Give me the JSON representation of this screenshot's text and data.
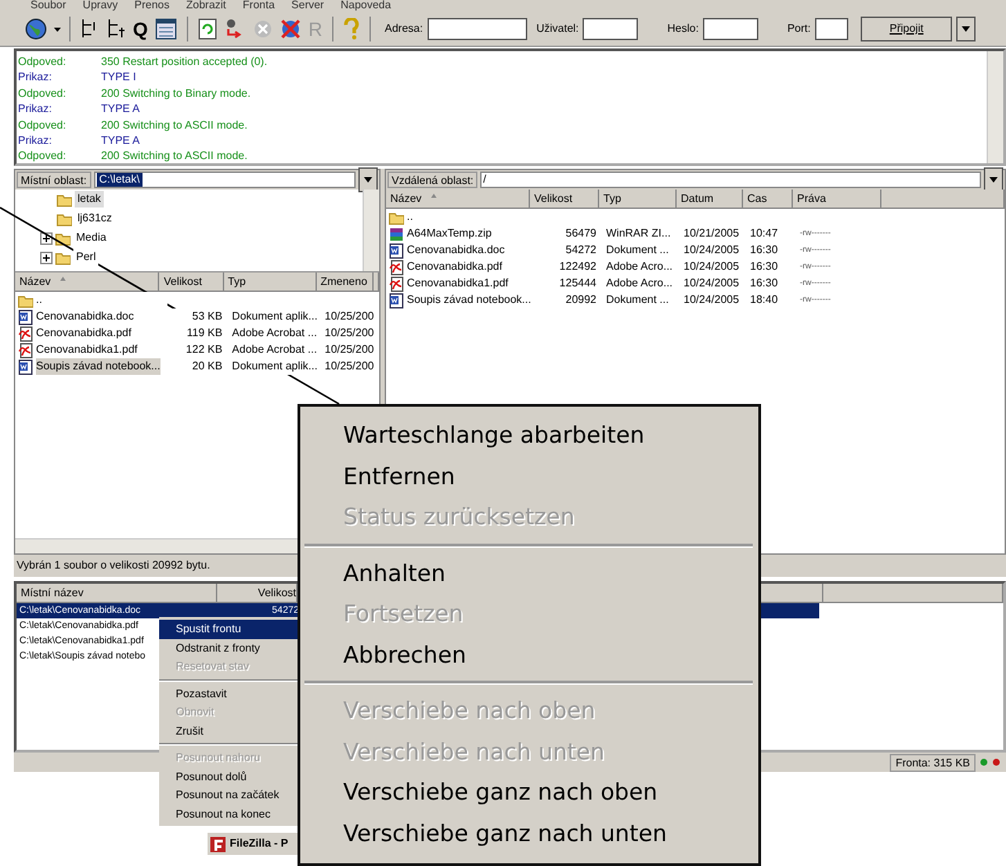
{
  "menu_bar": [
    "Soubor",
    "Upravy",
    "Prenos",
    "Zobrazit",
    "Fronta",
    "Server",
    "Napoveda"
  ],
  "toolbar": {
    "letter_buttons": [
      {
        "text": "Q",
        "disabled": false
      },
      {
        "text": "R",
        "disabled": true
      }
    ],
    "fields": [
      {
        "label": "Adresa:"
      },
      {
        "label": "Uživatel:"
      },
      {
        "label": "Heslo:"
      },
      {
        "label": "Port:"
      }
    ],
    "connect_button": "Připojit"
  },
  "log": [
    {
      "kind": "response",
      "label": "Odpoved:",
      "text": "350 Restart position accepted (0)."
    },
    {
      "kind": "command",
      "label": "Prikaz:",
      "text": "TYPE I"
    },
    {
      "kind": "response",
      "label": "Odpoved:",
      "text": "200 Switching to Binary mode."
    },
    {
      "kind": "command",
      "label": "Prikaz:",
      "text": "TYPE A"
    },
    {
      "kind": "response",
      "label": "Odpoved:",
      "text": "200 Switching to ASCII mode."
    },
    {
      "kind": "command",
      "label": "Prikaz:",
      "text": "TYPE A"
    },
    {
      "kind": "response",
      "label": "Odpoved:",
      "text": "200 Switching to ASCII mode."
    }
  ],
  "local": {
    "label": "Místní oblast:",
    "path": "C:\\letak\\",
    "tree": [
      {
        "name": "letak",
        "expandable": false,
        "selected": true
      },
      {
        "name": "lj631cz",
        "expandable": false,
        "selected": false
      },
      {
        "name": "Media",
        "expandable": true,
        "selected": false
      },
      {
        "name": "Perl",
        "expandable": true,
        "selected": false
      }
    ],
    "columns": [
      "Název",
      "Velikost",
      "Typ",
      "Zmeneno"
    ],
    "rows": [
      {
        "kind": "folder",
        "name": "..",
        "selected": false
      },
      {
        "kind": "doc",
        "name": "Cenovanabidka.doc",
        "size": "53 KB",
        "type": "Dokument aplik...",
        "date": "10/25/200",
        "selected": false
      },
      {
        "kind": "pdf",
        "name": "Cenovanabidka.pdf",
        "size": "119 KB",
        "type": "Adobe Acrobat ...",
        "date": "10/25/200",
        "selected": false
      },
      {
        "kind": "pdf",
        "name": "Cenovanabidka1.pdf",
        "size": "122 KB",
        "type": "Adobe Acrobat ...",
        "date": "10/25/200",
        "selected": false
      },
      {
        "kind": "doc",
        "name": "Soupis závad notebook...",
        "size": "20 KB",
        "type": "Dokument aplik...",
        "date": "10/25/200",
        "selected": true
      }
    ]
  },
  "remote": {
    "label": "Vzdálená oblast:",
    "path": "/",
    "columns": [
      "Název",
      "Velikost",
      "Typ",
      "Datum",
      "Cas",
      "Práva"
    ],
    "rows": [
      {
        "kind": "folder",
        "name": ".."
      },
      {
        "kind": "zip",
        "name": "A64MaxTemp.zip",
        "size": "56479",
        "type": "WinRAR ZI...",
        "date": "10/21/2005",
        "time": "10:47",
        "rights": "-rw-------"
      },
      {
        "kind": "doc",
        "name": "Cenovanabidka.doc",
        "size": "54272",
        "type": "Dokument ...",
        "date": "10/24/2005",
        "time": "16:30",
        "rights": "-rw-------"
      },
      {
        "kind": "pdf",
        "name": "Cenovanabidka.pdf",
        "size": "122492",
        "type": "Adobe Acro...",
        "date": "10/24/2005",
        "time": "16:30",
        "rights": "-rw-------"
      },
      {
        "kind": "pdf",
        "name": "Cenovanabidka1.pdf",
        "size": "125444",
        "type": "Adobe Acro...",
        "date": "10/24/2005",
        "time": "16:30",
        "rights": "-rw-------"
      },
      {
        "kind": "doc",
        "name": "Soupis závad notebook...",
        "size": "20992",
        "type": "Dokument ...",
        "date": "10/24/2005",
        "time": "18:40",
        "rights": "-rw-------"
      }
    ]
  },
  "status_text": "Vybrán 1 soubor o velikosti 20992 bytu.",
  "queue": {
    "columns": [
      "Místní název",
      "Velikost"
    ],
    "rows": [
      {
        "name": "C:\\letak\\Cenovanabidka.doc",
        "size": "54272",
        "selected": true
      },
      {
        "name": "C:\\letak\\Cenovanabidka.pdf",
        "selected": false
      },
      {
        "name": "C:\\letak\\Cenovanabidka1.pdf",
        "selected": false
      },
      {
        "name": "C:\\letak\\Soupis závad notebo",
        "selected": false
      }
    ]
  },
  "queue_menu": {
    "groups": [
      [
        {
          "label": "Spustit frontu",
          "disabled": false,
          "selected": true
        },
        {
          "label": "Odstranit z fronty",
          "disabled": false,
          "selected": false
        },
        {
          "label": "Resetovat stav",
          "disabled": true,
          "selected": false
        }
      ],
      [
        {
          "label": "Pozastavit",
          "disabled": false,
          "selected": false
        },
        {
          "label": "Obnovit",
          "disabled": true,
          "selected": false
        },
        {
          "label": "Zrušit",
          "disabled": false,
          "selected": false
        }
      ],
      [
        {
          "label": "Posunout nahoru",
          "disabled": true,
          "selected": false
        },
        {
          "label": "Posunout dolů",
          "disabled": false,
          "selected": false
        },
        {
          "label": "Posunout na začátek",
          "disabled": false,
          "selected": false
        },
        {
          "label": "Posunout na konec",
          "disabled": false,
          "selected": false
        }
      ]
    ]
  },
  "status_bar": {
    "queue_size": "Fronta: 315 KB"
  },
  "taskbar": {
    "button": "FileZilla - P"
  },
  "zoomed_menu": {
    "groups": [
      [
        {
          "label": "Warteschlange abarbeiten",
          "disabled": false
        },
        {
          "label": "Entfernen",
          "disabled": false
        },
        {
          "label": "Status zurücksetzen",
          "disabled": true
        }
      ],
      [
        {
          "label": "Anhalten",
          "disabled": false
        },
        {
          "label": "Fortsetzen",
          "disabled": true
        },
        {
          "label": "Abbrechen",
          "disabled": false
        }
      ],
      [
        {
          "label": "Verschiebe nach oben",
          "disabled": true
        },
        {
          "label": "Verschiebe nach unten",
          "disabled": true
        },
        {
          "label": "Verschiebe ganz nach oben",
          "disabled": false
        },
        {
          "label": "Verschiebe ganz nach unten",
          "disabled": false
        }
      ]
    ]
  }
}
